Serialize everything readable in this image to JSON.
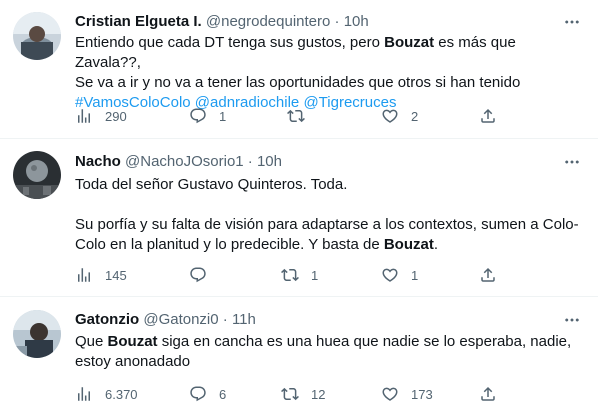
{
  "tweets": [
    {
      "name": "Cristian Elgueta I.",
      "handle": "@negrodequintero",
      "sep": "·",
      "time": "10h",
      "line1_a": "Entiendo que cada DT tenga sus gustos, pero ",
      "line1_b": "Bouzat",
      "line1_c": " es más que Zavala??,",
      "line2": "Se va a ir y no va a tener las oportunidades que otros si han tenido",
      "tag1": "#VamosColoColo",
      "tag2": "@adnradiochile",
      "tag3": "@Tigrecruces",
      "views": "290",
      "replies": "1",
      "retweets": "",
      "likes": "2"
    },
    {
      "name": "Nacho",
      "handle": "@NachoJOsorio1",
      "sep": "·",
      "time": "10h",
      "para1": "Toda del señor Gustavo Quinteros. Toda.",
      "para2_line1": "Su porfía y su falta de visión para adaptarse a los contextos, sumen a Colo-",
      "para2_line2_a": "Colo en la planitud y lo predecible. Y basta de ",
      "para2_line2_b": "Bouzat",
      "para2_line2_c": ".",
      "views": "145",
      "replies": "",
      "retweets": "1",
      "likes": "1"
    },
    {
      "name": "Gatonzio",
      "handle": "@Gatonzi0",
      "sep": "·",
      "time": "11h",
      "line1_a": "Que ",
      "line1_b": "Bouzat",
      "line1_c": " siga en cancha es una huea que nadie se lo esperaba, nadie,",
      "line2": "estoy anonadado",
      "views": "6.370",
      "replies": "6",
      "retweets": "12",
      "likes": "173"
    }
  ],
  "icons": {
    "views": "bar-chart-icon",
    "reply": "speech-bubble-icon",
    "retweet": "retweet-icon",
    "like": "heart-icon",
    "share": "share-upload-icon",
    "more": "more-dots-icon"
  },
  "colors": {
    "link": "#1d9bf0",
    "muted": "#536471",
    "text": "#0f1419",
    "divider": "#eff3f4"
  }
}
